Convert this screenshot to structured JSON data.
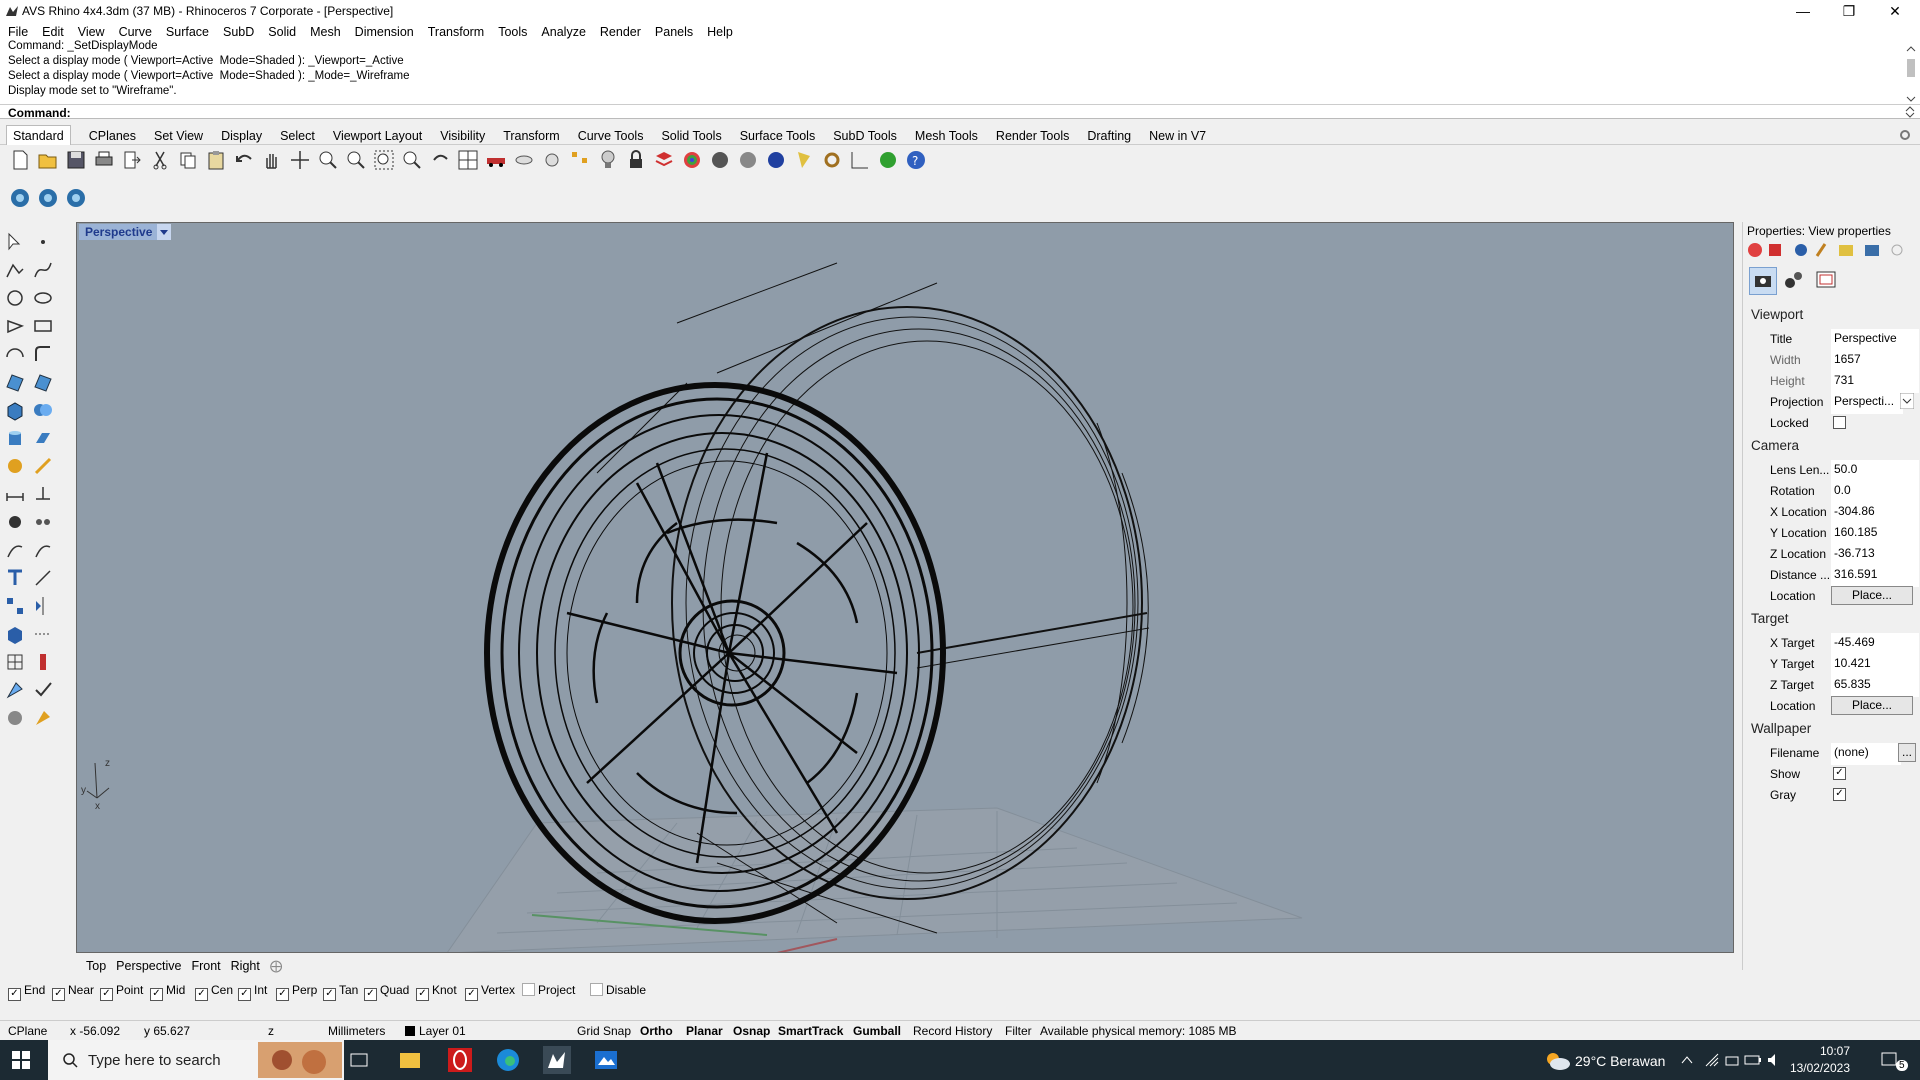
{
  "window": {
    "title": "AVS Rhino 4x4.3dm (37 MB) - Rhinoceros 7 Corporate - [Perspective]"
  },
  "menu": [
    "File",
    "Edit",
    "View",
    "Curve",
    "Surface",
    "SubD",
    "Solid",
    "Mesh",
    "Dimension",
    "Transform",
    "Tools",
    "Analyze",
    "Render",
    "Panels",
    "Help"
  ],
  "command_history": [
    "Command: _SetDisplayMode",
    "Select a display mode ( Viewport=Active  Mode=Shaded ): _Viewport=_Active",
    "Select a display mode ( Viewport=Active  Mode=Shaded ): _Mode=_Wireframe",
    "Display mode set to \"Wireframe\"."
  ],
  "command_prompt": "Command:",
  "toolbar_tabs": [
    "Standard",
    "CPlanes",
    "Set View",
    "Display",
    "Select",
    "Viewport Layout",
    "Visibility",
    "Transform",
    "Curve Tools",
    "Solid Tools",
    "Surface Tools",
    "SubD Tools",
    "Mesh Tools",
    "Render Tools",
    "Drafting",
    "New in V7"
  ],
  "viewport": {
    "title": "Perspective",
    "axis_z": "z",
    "axis_y": "y",
    "axis_x": "x"
  },
  "viewport_tabs": [
    "Top",
    "Perspective",
    "Front",
    "Right"
  ],
  "osnap": [
    {
      "label": "End",
      "checked": true
    },
    {
      "label": "Near",
      "checked": true
    },
    {
      "label": "Point",
      "checked": true
    },
    {
      "label": "Mid",
      "checked": true
    },
    {
      "label": "Cen",
      "checked": true
    },
    {
      "label": "Int",
      "checked": true
    },
    {
      "label": "Perp",
      "checked": true
    },
    {
      "label": "Tan",
      "checked": true
    },
    {
      "label": "Quad",
      "checked": true
    },
    {
      "label": "Knot",
      "checked": true
    },
    {
      "label": "Vertex",
      "checked": true
    },
    {
      "label": "Project",
      "checked": false
    },
    {
      "label": "Disable",
      "checked": false
    }
  ],
  "status": {
    "cplane": "CPlane",
    "x": "x -56.092",
    "y": "y 65.627",
    "z": "z",
    "units": "Millimeters",
    "layer": "Layer 01",
    "grid_snap": "Grid Snap",
    "ortho": "Ortho",
    "planar": "Planar",
    "osnap": "Osnap",
    "smarttrack": "SmartTrack",
    "gumball": "Gumball",
    "record_history": "Record History",
    "filter": "Filter",
    "memory": "Available physical memory: 1085 MB"
  },
  "properties": {
    "header": "Properties: View properties",
    "viewport_section": "Viewport",
    "title_label": "Title",
    "title_value": "Perspective",
    "width_label": "Width",
    "width_value": "1657",
    "height_label": "Height",
    "height_value": "731",
    "projection_label": "Projection",
    "projection_value": "Perspecti...",
    "locked_label": "Locked",
    "camera_section": "Camera",
    "lens_label": "Lens Len...",
    "lens_value": "50.0",
    "rotation_label": "Rotation",
    "rotation_value": "0.0",
    "xloc_label": "X Location",
    "xloc_value": "-304.86",
    "yloc_label": "Y Location",
    "yloc_value": "160.185",
    "zloc_label": "Z Location",
    "zloc_value": "-36.713",
    "distance_label": "Distance ...",
    "distance_value": "316.591",
    "cam_location_label": "Location",
    "place_button": "Place...",
    "target_section": "Target",
    "xtarget_label": "X Target",
    "xtarget_value": "-45.469",
    "ytarget_label": "Y Target",
    "ytarget_value": "10.421",
    "ztarget_label": "Z Target",
    "ztarget_value": "65.835",
    "target_location_label": "Location",
    "wallpaper_section": "Wallpaper",
    "filename_label": "Filename",
    "filename_value": "(none)",
    "browse_button": "...",
    "show_label": "Show",
    "gray_label": "Gray"
  },
  "taskbar": {
    "search_placeholder": "Type here to search",
    "weather": "29°C  Berawan",
    "time": "10:07",
    "date": "13/02/2023",
    "notifications": "5"
  }
}
